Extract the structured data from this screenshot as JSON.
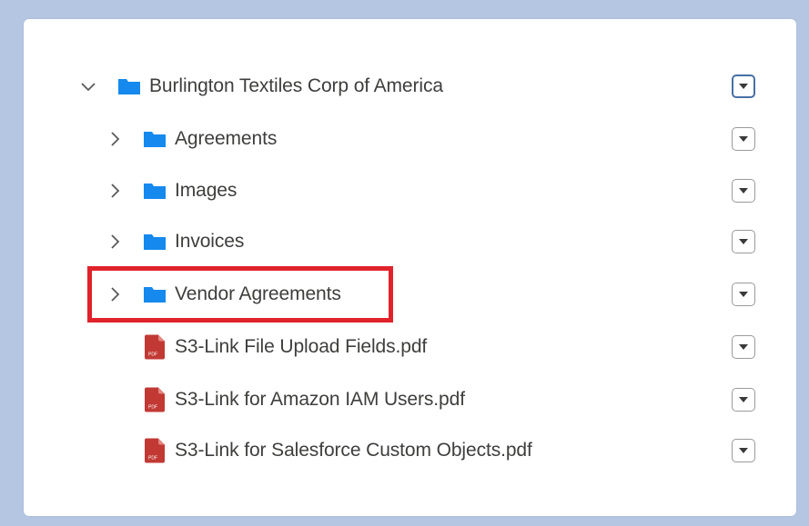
{
  "colors": {
    "background": "#b4c6e2",
    "folder": "#1589ee",
    "pdf": "#c23934",
    "highlight": "#e0222a"
  },
  "tree": {
    "root": {
      "label": "Burlington Textiles Corp of America",
      "icon": "folder-icon",
      "expanded": true
    },
    "folders": [
      {
        "label": "Agreements",
        "icon": "folder-icon",
        "expanded": false
      },
      {
        "label": "Images",
        "icon": "folder-icon",
        "expanded": false
      },
      {
        "label": "Invoices",
        "icon": "folder-icon",
        "expanded": false
      },
      {
        "label": "Vendor Agreements",
        "icon": "folder-icon",
        "expanded": false,
        "highlighted": true
      }
    ],
    "files": [
      {
        "label": "S3-Link File Upload Fields.pdf",
        "icon": "pdf-file-icon",
        "icon_text": "PDF"
      },
      {
        "label": "S3-Link for Amazon IAM Users.pdf",
        "icon": "pdf-file-icon",
        "icon_text": "PDF"
      },
      {
        "label": "S3-Link for Salesforce Custom Objects.pdf",
        "icon": "pdf-file-icon",
        "icon_text": "PDF"
      }
    ]
  }
}
